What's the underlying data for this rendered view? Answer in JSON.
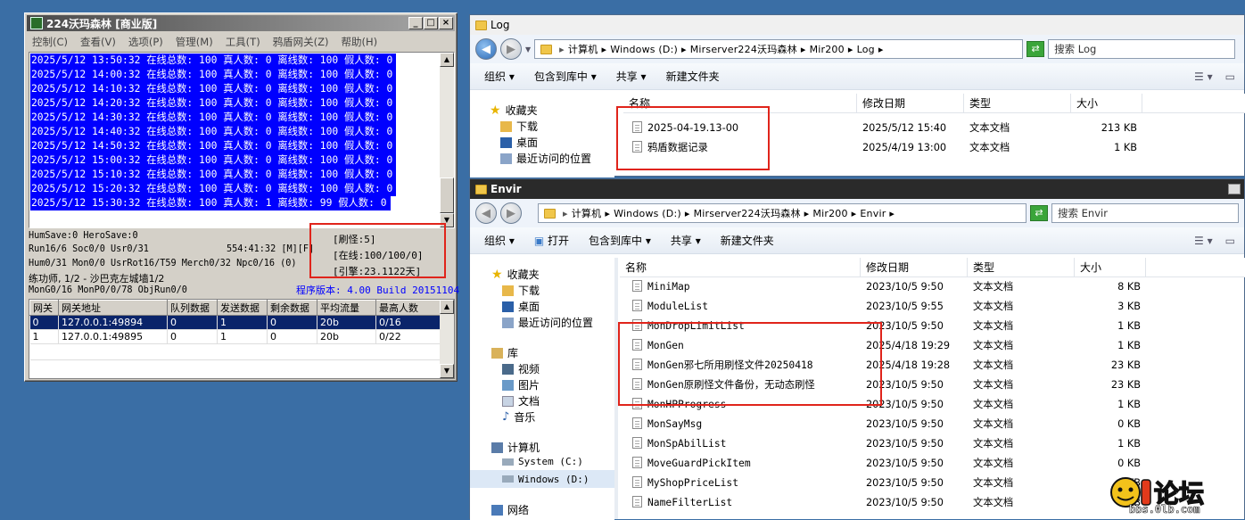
{
  "m2": {
    "title": "224沃玛森林 [商业版]",
    "menu": [
      "控制(C)",
      "查看(V)",
      "选项(P)",
      "管理(M)",
      "工具(T)",
      "鸦盾网关(Z)",
      "帮助(H)"
    ],
    "log": [
      "2025/5/12 13:50:32 在线总数: 100 真人数: 0 离线数: 100 假人数: 0",
      "2025/5/12 14:00:32 在线总数: 100 真人数: 0 离线数: 100 假人数: 0",
      "2025/5/12 14:10:32 在线总数: 100 真人数: 0 离线数: 100 假人数: 0",
      "2025/5/12 14:20:32 在线总数: 100 真人数: 0 离线数: 100 假人数: 0",
      "2025/5/12 14:30:32 在线总数: 100 真人数: 0 离线数: 100 假人数: 0",
      "2025/5/12 14:40:32 在线总数: 100 真人数: 0 离线数: 100 假人数: 0",
      "2025/5/12 14:50:32 在线总数: 100 真人数: 0 离线数: 100 假人数: 0",
      "2025/5/12 15:00:32 在线总数: 100 真人数: 0 离线数: 100 假人数: 0",
      "2025/5/12 15:10:32 在线总数: 100 真人数: 0 离线数: 100 假人数: 0",
      "2025/5/12 15:20:32 在线总数: 100 真人数: 0 离线数: 100 假人数: 0",
      "2025/5/12 15:30:32 在线总数: 100 真人数: 1 离线数: 99 假人数: 0"
    ],
    "status": {
      "line1": "HumSave:0 HeroSave:0",
      "line2a": "Run16/6 Soc0/0 Usr0/31",
      "line2b": "554:41:32 [M][F]",
      "line3": "Hum0/31 Mon0/0 UsrRot16/T59 Merch0/32 Npc0/16 (0)",
      "line4": "练功师, 1/2 - 沙巴克左城墙1/2",
      "line5": "MonG0/16 MonP0/0/78 ObjRun0/0",
      "version": "程序版本: 4.00 Build 20151104",
      "refresh": "[刷怪:5]",
      "online": "[在线:100/100/0]",
      "engine": "[引擎:23.1122天]"
    },
    "gateway": {
      "headers": [
        "网关",
        "网关地址",
        "队列数据",
        "发送数据",
        "剩余数据",
        "平均流量",
        "最高人数"
      ],
      "rows": [
        [
          "0",
          "127.0.0.1:49894",
          "0",
          "1",
          "0",
          "20b",
          "0/16"
        ],
        [
          "1",
          "127.0.0.1:49895",
          "0",
          "1",
          "0",
          "20b",
          "0/22"
        ]
      ]
    }
  },
  "log_window": {
    "title": "Log",
    "address": [
      "计算机",
      "Windows (D:)",
      "Mirserver224沃玛森林",
      "Mir200",
      "Log"
    ],
    "search_placeholder": "搜索 Log",
    "toolbar": [
      "组织",
      "包含到库中",
      "共享",
      "新建文件夹"
    ],
    "nav": {
      "favorites": "收藏夹",
      "downloads": "下载",
      "desktop": "桌面",
      "recent": "最近访问的位置"
    },
    "columns": [
      "名称",
      "修改日期",
      "类型",
      "大小"
    ],
    "files": [
      {
        "name": "2025-04-19.13-00",
        "date": "2025/5/12 15:40",
        "type": "文本文档",
        "size": "213 KB"
      },
      {
        "name": "鸦盾数据记录",
        "date": "2025/4/19 13:00",
        "type": "文本文档",
        "size": "1 KB"
      }
    ]
  },
  "envir_window": {
    "title": "Envir",
    "address": [
      "计算机",
      "Windows (D:)",
      "Mirserver224沃玛森林",
      "Mir200",
      "Envir"
    ],
    "search_placeholder": "搜索 Envir",
    "toolbar": [
      "组织",
      "打开",
      "包含到库中",
      "共享",
      "新建文件夹"
    ],
    "nav": {
      "favorites": "收藏夹",
      "downloads": "下载",
      "desktop": "桌面",
      "recent": "最近访问的位置",
      "library": "库",
      "videos": "视频",
      "pictures": "图片",
      "documents": "文档",
      "music": "音乐",
      "computer": "计算机",
      "system": "System (C:)",
      "windows": "Windows (D:)",
      "network": "网络"
    },
    "columns": [
      "名称",
      "修改日期",
      "类型",
      "大小"
    ],
    "files": [
      {
        "name": "MiniMap",
        "date": "2023/10/5 9:50",
        "type": "文本文档",
        "size": "8 KB"
      },
      {
        "name": "ModuleList",
        "date": "2023/10/5 9:55",
        "type": "文本文档",
        "size": "3 KB"
      },
      {
        "name": "MonDropLimitList",
        "date": "2023/10/5 9:50",
        "type": "文本文档",
        "size": "1 KB"
      },
      {
        "name": "MonGen",
        "date": "2025/4/18 19:29",
        "type": "文本文档",
        "size": "1 KB"
      },
      {
        "name": "MonGen邪七所用刷怪文件20250418",
        "date": "2025/4/18 19:28",
        "type": "文本文档",
        "size": "23 KB"
      },
      {
        "name": "MonGen原刷怪文件备份，无动态刷怪",
        "date": "2023/10/5 9:50",
        "type": "文本文档",
        "size": "23 KB"
      },
      {
        "name": "MonHPProgress",
        "date": "2023/10/5 9:50",
        "type": "文本文档",
        "size": "1 KB"
      },
      {
        "name": "MonSayMsg",
        "date": "2023/10/5 9:50",
        "type": "文本文档",
        "size": "0 KB"
      },
      {
        "name": "MonSpAbilList",
        "date": "2023/10/5 9:50",
        "type": "文本文档",
        "size": "1 KB"
      },
      {
        "name": "MoveGuardPickItem",
        "date": "2023/10/5 9:50",
        "type": "文本文档",
        "size": "0 KB"
      },
      {
        "name": "MyShopPriceList",
        "date": "2023/10/5 9:50",
        "type": "文本文档",
        "size": "0 KB"
      },
      {
        "name": "NameFilterList",
        "date": "2023/10/5 9:50",
        "type": "文本文档",
        "size": "1 KB"
      }
    ]
  },
  "watermark": {
    "text": "论坛",
    "url": "bbs.0lb.com"
  }
}
